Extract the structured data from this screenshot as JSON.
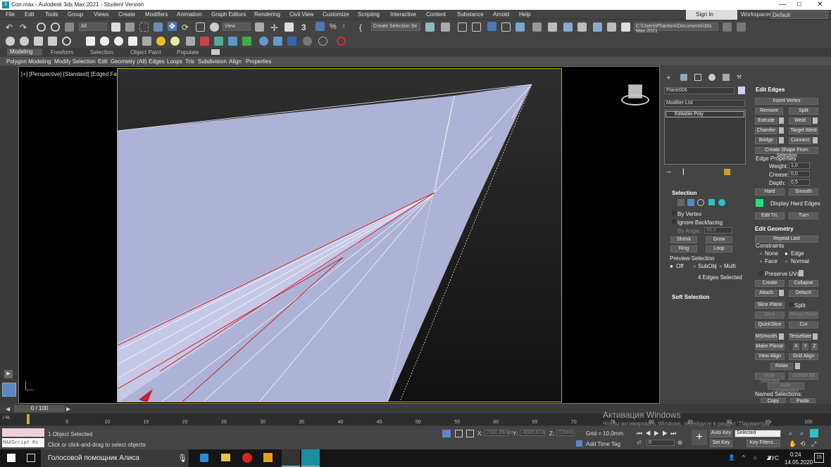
{
  "window": {
    "title": "Con.max - Autodesk 3ds Max 2021 - Student Version",
    "min": "—",
    "max": "□",
    "close": "✕"
  },
  "menu": [
    "File",
    "Edit",
    "Tools",
    "Group",
    "Views",
    "Create",
    "Modifiers",
    "Animation",
    "Graph Editors",
    "Rendering",
    "Civil View",
    "Customize",
    "Scripting",
    "Interactive",
    "Content",
    "Substance",
    "Arnold",
    "Help"
  ],
  "signin": "Sign In",
  "workspaces_label": "Workspaces:",
  "workspace": "Default",
  "toolbar": {
    "filter": "All",
    "refcoord": "View",
    "selset": "Create Selection Se",
    "path": "C:\\Users\\Phantom\\Documents\\3ds Max 2021"
  },
  "ribbon_tabs": [
    "Modeling",
    "Freeform",
    "Selection",
    "Object Paint",
    "Populate"
  ],
  "ribbon": [
    "Polygon Modeling",
    "Modify Selection",
    "Edit",
    "Geometry (All)",
    "Edges",
    "Loops",
    "Tris",
    "Subdivision",
    "Align",
    "Properties"
  ],
  "viewport_label": "[+] [Perspective] [Standard] [Edged Faces]",
  "panel": {
    "object_name": "Plane006",
    "modifier_list": "Modifier List",
    "stack_item": "Editable Poly",
    "selection": {
      "title": "Selection",
      "by_vertex": "By Vertex",
      "ignore_backfacing": "Ignore Backfacing",
      "by_angle": "By Angle:",
      "angle": "45,0",
      "shrink": "Shrink",
      "grow": "Grow",
      "ring": "Ring",
      "loop": "Loop",
      "preview": "Preview Selection",
      "off": "Off",
      "subobj": "SubObj",
      "multi": "Multi",
      "status": "4 Edges Selected"
    },
    "soft": "Soft Selection",
    "edit_edges": {
      "title": "Edit Edges",
      "insert_vertex": "Insert Vertex",
      "remove": "Remove",
      "split": "Split",
      "extrude": "Extrude",
      "weld": "Weld",
      "chamfer": "Chamfer",
      "target_weld": "Target Weld",
      "bridge": "Bridge",
      "connect": "Connect",
      "create_shape": "Create Shape From Selection",
      "props": "Edge Properties",
      "weight": "Weight:",
      "weight_v": "1,0",
      "crease": "Crease:",
      "crease_v": "0,0",
      "depth": "Depth:",
      "depth_v": "0,5",
      "hard": "Hard",
      "smooth": "Smooth",
      "display_hard": "Display Hard Edges",
      "edit_tri": "Edit Tri.",
      "turn": "Turn"
    },
    "edit_geom": {
      "title": "Edit Geometry",
      "repeat": "Repeat Last",
      "constraints": "Constraints",
      "none": "None",
      "edge": "Edge",
      "face": "Face",
      "normal": "Normal",
      "preserve": "Preserve UVs",
      "create": "Create",
      "collapse": "Collapse",
      "attach": "Attach",
      "detach": "Detach",
      "slice_plane": "Slice Plane",
      "split": "Split",
      "slice": "Slice",
      "reset_plane": "Reset Plane",
      "quickslice": "QuickSlice",
      "cut": "Cut",
      "msmooth": "MSmooth",
      "tessellate": "Tessellate",
      "make_planar": "Make Planar",
      "x": "X",
      "y": "Y",
      "z": "Z",
      "view_align": "View Align",
      "grid_align": "Grid Align",
      "relax": "Relax",
      "hide_sel": "Hide Selected",
      "unhide_all": "Unhide All",
      "hide_unsel": "Hide Unselected",
      "named": "Named Selections:",
      "copy": "Copy",
      "paste": "Paste"
    }
  },
  "timeline": {
    "frame": "0 / 100",
    "ticks": [
      "0",
      "5",
      "10",
      "15",
      "20",
      "25",
      "30",
      "35",
      "40",
      "45",
      "50",
      "55",
      "60",
      "65",
      "70",
      "75",
      "80",
      "85",
      "90",
      "95",
      "100"
    ]
  },
  "status": {
    "maxscript": "MAXScript Mi",
    "selected": "1 Object Selected",
    "prompt": "Click or click-and-drag to select objects",
    "x": "X:",
    "xv": "2181,05mm",
    "y": "Y:",
    "yv": "-6000,614r",
    "z": "Z:",
    "zv": "0,0mm",
    "grid": "Grid = 10,0mm",
    "add_tag": "Add Time Tag",
    "autokey": "Auto Key",
    "selected_dd": "Selected",
    "setkey": "Set Key",
    "keyfilters": "Key Filters...",
    "frame": "0"
  },
  "activation": {
    "line1": "Активация Windows",
    "line2": "Чтобы активировать Windows, перейдите в раздел \"Параметры\"."
  },
  "taskbar": {
    "search": "Голосовой помощник Алиса",
    "lang": "РУС",
    "time": "0:24",
    "date": "14.05.2020",
    "notif": "15"
  },
  "colors": {
    "accent": "#5b87c9",
    "highlight": "#c8b400",
    "edge_sel": "#c0242f",
    "mesh": "#aeb2d6",
    "hard_edge": "#22e07a"
  }
}
